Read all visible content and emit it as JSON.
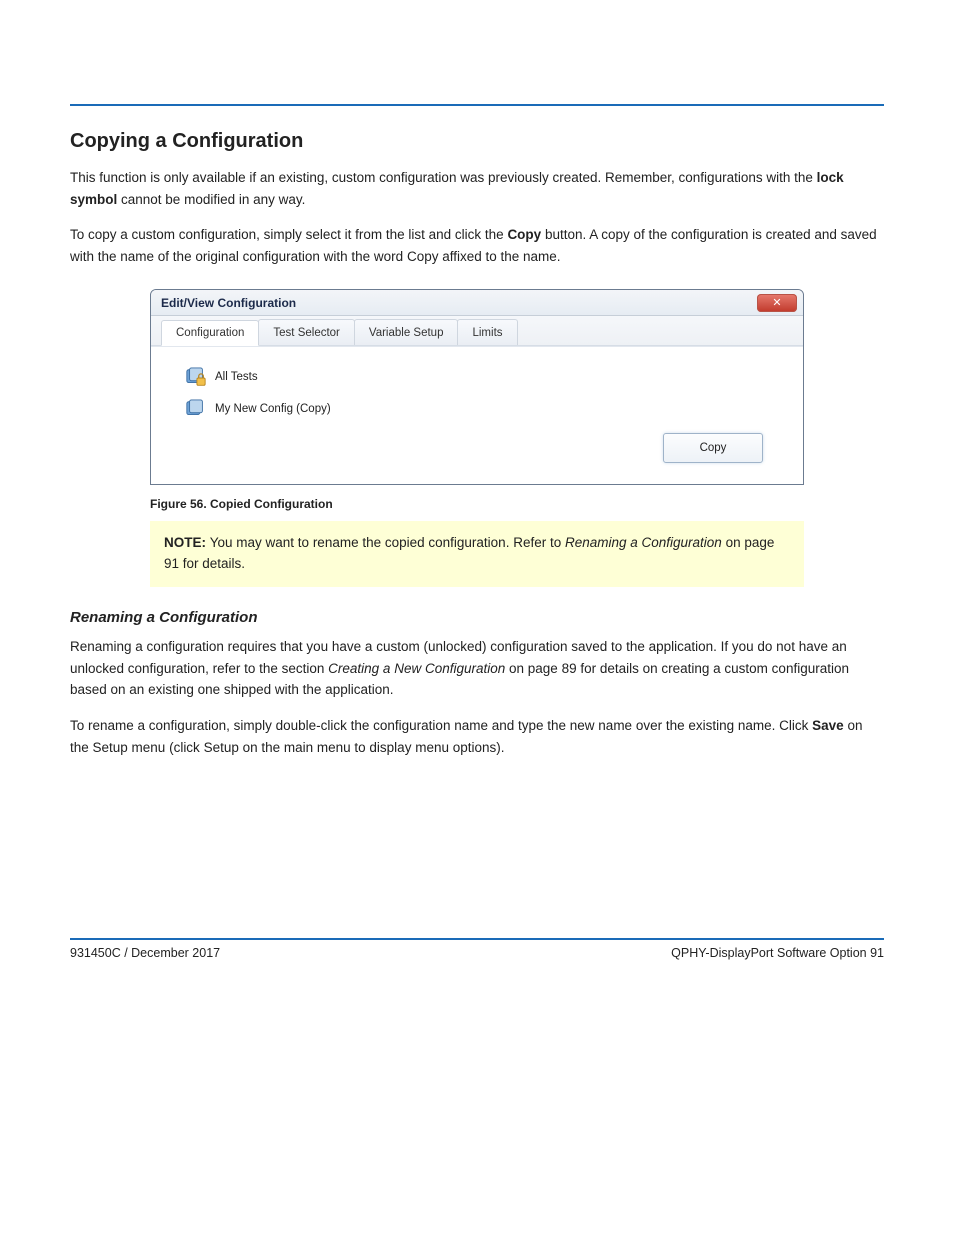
{
  "header": {
    "rule_color": "#1a6bb8"
  },
  "sections": {
    "copy_title": "Copying a Configuration",
    "copy_p1_a": "This function is only available if an existing, custom configuration was previously created. Remember, configurations with the ",
    "copy_p1_lock": "lock symbol",
    "copy_p1_b": " cannot be modified in any way.",
    "copy_p2_a": "To copy a custom configuration, simply select it from the list and click the ",
    "copy_p2_btn": "Copy",
    "copy_p2_b": " button. A copy of the configuration is created and saved with the name of the original configuration with the word Copy affixed to the name.",
    "rename_title": "Renaming a Configuration",
    "rename_p1_a": "Renaming a configuration requires that you have a custom (unlocked) configuration saved to the application. If you do not have an unlocked configuration, refer to the section ",
    "rename_p1_link": "Creating a New Configuration",
    "rename_p1_b": " on page 89 for details on creating a custom configuration based on an existing one shipped with the application.",
    "rename_p2_a": "To rename a configuration, simply double-click the configuration name and type the new name over the existing name. Click ",
    "rename_p2_btn": "Save",
    "rename_p2_b": " on the Setup menu (click Setup on the main menu to display menu options)."
  },
  "dialog": {
    "title": "Edit/View Configuration",
    "tabs": {
      "configuration": "Configuration",
      "test_selector": "Test Selector",
      "variable_setup": "Variable Setup",
      "limits": "Limits"
    },
    "items": {
      "all_tests": "All Tests",
      "my_copy": "My New Config  (Copy)"
    },
    "copy_btn": "Copy"
  },
  "figure": {
    "caption": "Figure 56. Copied Configuration"
  },
  "note": {
    "label": "NOTE: ",
    "text_a": "You may want to rename the copied configuration. Refer to ",
    "text_link": "Renaming a Configuration",
    "text_b": " on page 91 for details."
  },
  "footer": {
    "left": "931450C / December 2017",
    "right": "QPHY-DisplayPort Software Option      91"
  }
}
